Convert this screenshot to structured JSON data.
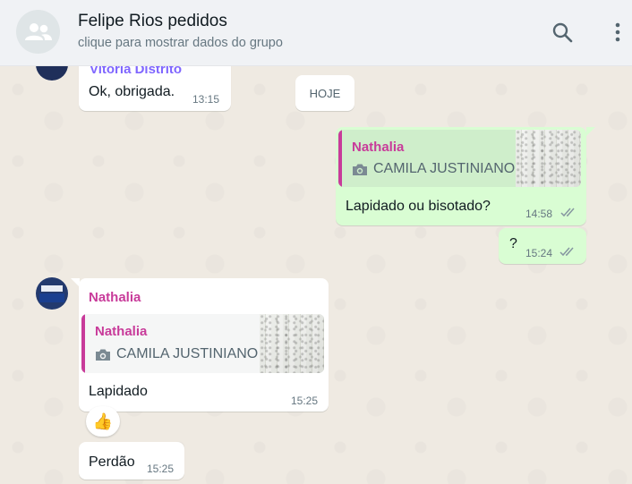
{
  "header": {
    "title": "Felipe Rios pedidos",
    "subtitle": "clique para mostrar dados do grupo",
    "avatar_icon": "group-icon",
    "search_icon": "search-icon",
    "menu_icon": "kebab-menu-icon"
  },
  "messages": {
    "m1": {
      "sender": "Vitoria Distrito",
      "text": "Ok, obrigada.",
      "time": "13:15"
    },
    "date_divider": "HOJE",
    "m2": {
      "quote_author": "Nathalia",
      "quote_text": "CAMILA JUSTINIANO",
      "text": "Lapidado ou bisotado?",
      "time": "14:58",
      "status": "read"
    },
    "m3": {
      "text": "?",
      "time": "15:24",
      "status": "read"
    },
    "m4": {
      "sender": "Nathalia",
      "quote_author": "Nathalia",
      "quote_text": "CAMILA JUSTINIANO",
      "text": "Lapidado",
      "time": "15:25",
      "reaction": "👍"
    },
    "m5": {
      "text": "Perdão",
      "time": "15:25"
    }
  },
  "colors": {
    "header_bg": "#f0f2f5",
    "chat_bg": "#efeae2",
    "outgoing_bubble": "#d9fdd3",
    "incoming_bubble": "#ffffff",
    "sender_vitoria": "#7f66ff",
    "sender_nathalia": "#c83b9a",
    "read_ticks": "#8696a0"
  }
}
